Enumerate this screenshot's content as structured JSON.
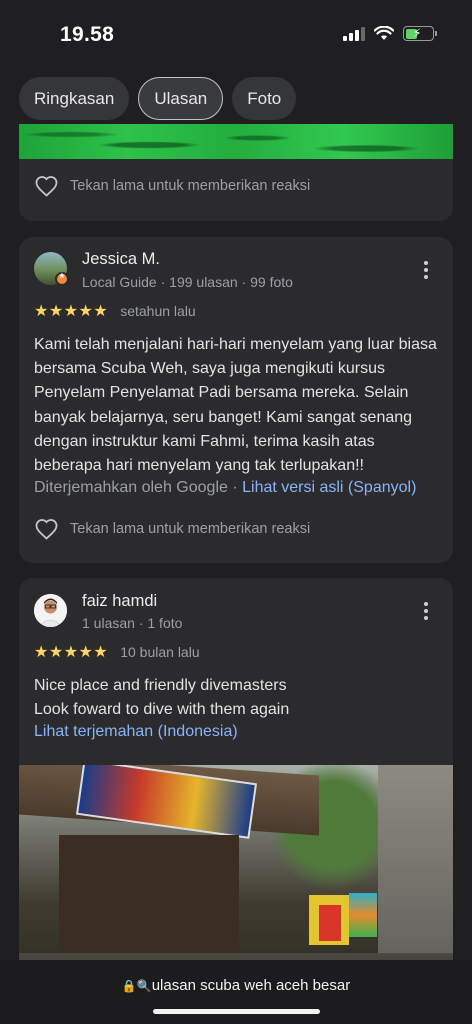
{
  "status": {
    "time": "19.58"
  },
  "tabs": [
    {
      "label": "Ringkasan"
    },
    {
      "label": "Ulasan"
    },
    {
      "label": "Foto"
    }
  ],
  "reaction_hint": "Tekan lama untuk memberikan reaksi",
  "reviews": [
    {
      "name": "Jessica M.",
      "meta": "Local Guide · 199 ulasan · 99 foto",
      "stars": "★★★★★",
      "rating": 5,
      "when": "setahun lalu",
      "text": "Kami telah menjalani hari-hari menyelam yang luar biasa bersama Scuba Weh, saya juga mengikuti kursus Penyelam Penyelamat Padi bersama mereka. Selain banyak belajarnya, seru banget! Kami sangat senang dengan instruktur kami Fahmi, terima kasih atas beberapa hari menyelam yang tak terlupakan!!",
      "translated_by": "Diterjemahkan oleh Google · ",
      "original_link": "Lihat versi asli (Spanyol)"
    },
    {
      "name": "faiz hamdi",
      "meta": "1 ulasan · 1 foto",
      "stars": "★★★★★",
      "rating": 5,
      "when": "10 bulan lalu",
      "text_line1": "Nice place and friendly divemasters",
      "text_line2": "Look foward to dive with them again",
      "translate_link": "Lihat terjemahan (Indonesia)"
    }
  ],
  "browser": {
    "url": "ulasan scuba weh aceh besar"
  }
}
